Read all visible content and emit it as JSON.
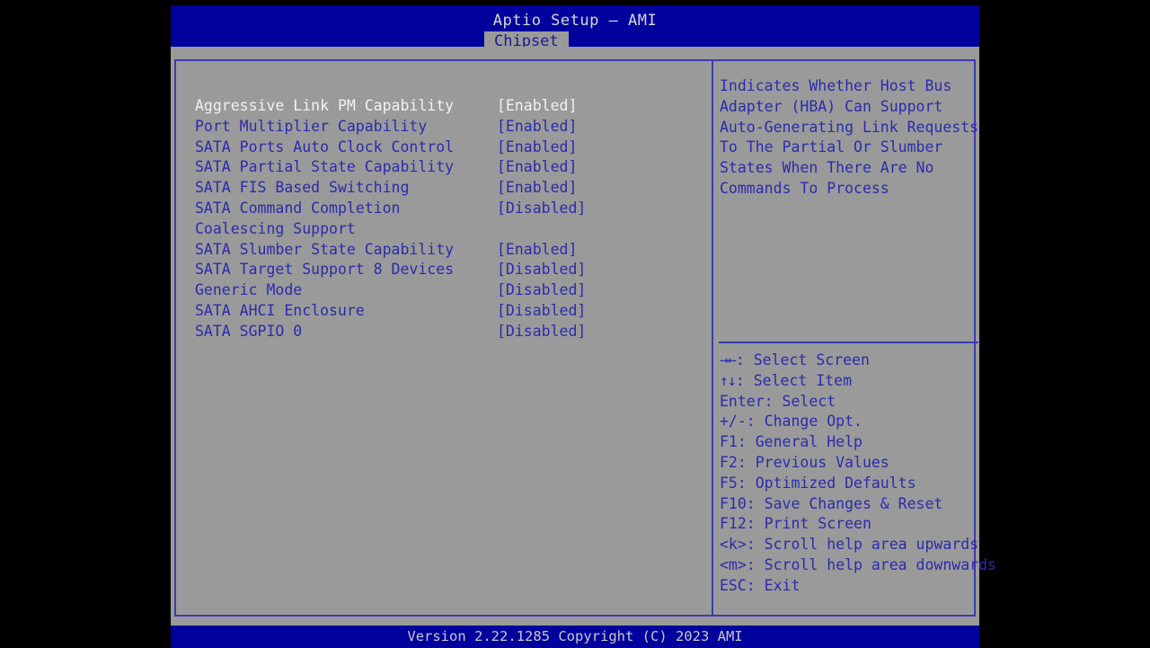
{
  "header": {
    "title": "Aptio Setup – AMI",
    "active_tab": "Chipset",
    "tabs": [
      "Chipset"
    ]
  },
  "settings": {
    "rows": [
      {
        "label": "Aggressive Link PM Capability",
        "value": "[Enabled]",
        "selected": true
      },
      {
        "label": "Port Multiplier Capability",
        "value": "[Enabled]",
        "selected": false
      },
      {
        "label": "SATA Ports Auto Clock Control",
        "value": "[Enabled]",
        "selected": false
      },
      {
        "label": "SATA Partial State Capability",
        "value": "[Enabled]",
        "selected": false
      },
      {
        "label": "SATA FIS Based Switching",
        "value": "[Enabled]",
        "selected": false
      },
      {
        "label": "SATA Command Completion",
        "value": "[Disabled]",
        "selected": false
      },
      {
        "label": "Coalescing Support",
        "value": "",
        "selected": false
      },
      {
        "label": "SATA Slumber State Capability",
        "value": "[Enabled]",
        "selected": false
      },
      {
        "label": "SATA Target Support 8 Devices",
        "value": "[Disabled]",
        "selected": false
      },
      {
        "label": "Generic Mode",
        "value": "[Disabled]",
        "selected": false
      },
      {
        "label": "SATA AHCI Enclosure",
        "value": "[Disabled]",
        "selected": false
      },
      {
        "label": "SATA SGPIO 0",
        "value": "[Disabled]",
        "selected": false
      }
    ]
  },
  "help": {
    "description": "Indicates Whether Host Bus\nAdapter (HBA) Can Support\nAuto-Generating Link Requests\nTo The Partial Or Slumber\nStates When There Are No\nCommands To Process",
    "keys": [
      {
        "glyph": "→←",
        "text": ": Select Screen"
      },
      {
        "glyph": "↑↓",
        "text": ": Select Item"
      },
      {
        "glyph": "",
        "text": "Enter: Select"
      },
      {
        "glyph": "",
        "text": "+/-: Change Opt."
      },
      {
        "glyph": "",
        "text": "F1: General Help"
      },
      {
        "glyph": "",
        "text": "F2: Previous Values"
      },
      {
        "glyph": "",
        "text": "F5: Optimized Defaults"
      },
      {
        "glyph": "",
        "text": "F10: Save Changes & Reset"
      },
      {
        "glyph": "",
        "text": "F12: Print Screen"
      },
      {
        "glyph": "",
        "text": "<k>: Scroll help area upwards"
      },
      {
        "glyph": "",
        "text": "<m>: Scroll help area downwards"
      },
      {
        "glyph": "",
        "text": "ESC: Exit"
      }
    ]
  },
  "footer": {
    "version": "Version 2.22.1285 Copyright (C) 2023 AMI"
  },
  "colors": {
    "header_blue": "#00009c",
    "panel_gray": "#9a9a9a",
    "text_blue": "#2b2bac",
    "border_blue": "#3b3bb0",
    "selected_text": "#f2f2f2",
    "title_text": "#d8d8d8"
  }
}
